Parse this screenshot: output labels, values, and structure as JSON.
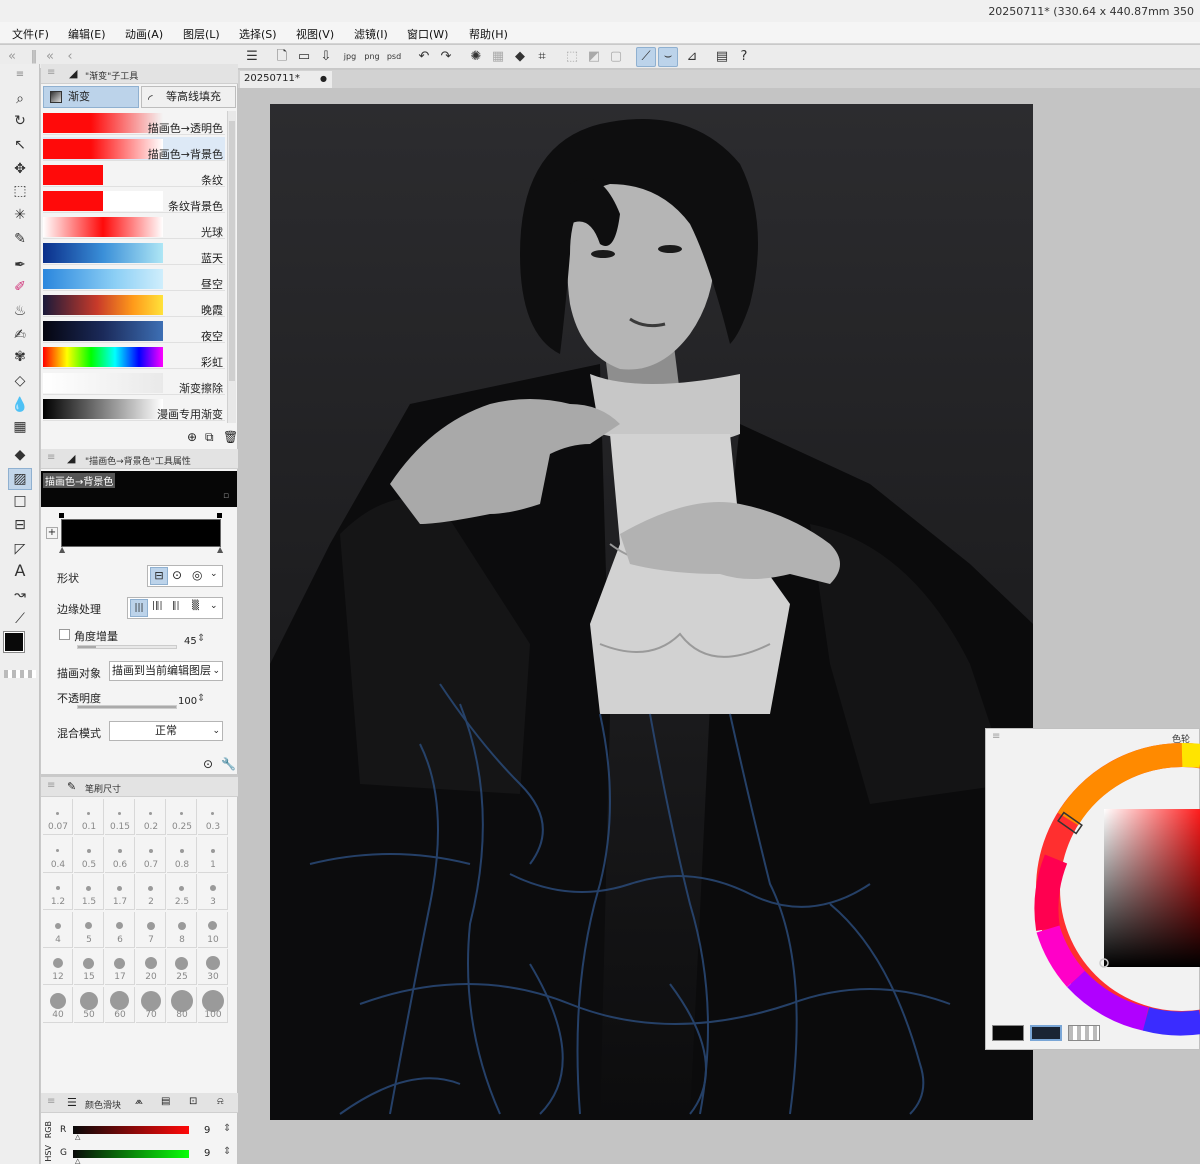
{
  "titlebar": {
    "text": "20250711* (330.64 x 440.87mm 350"
  },
  "menu": [
    "文件(F)",
    "编辑(E)",
    "动画(A)",
    "图层(L)",
    "选择(S)",
    "视图(V)",
    "滤镜(I)",
    "窗口(W)",
    "帮助(H)"
  ],
  "document": {
    "tab_label": "20250711*",
    "tab_marker": "●"
  },
  "subtool": {
    "panel_title": "\"渐变\"子工具",
    "tabs": [
      "渐变",
      "等高线填充"
    ],
    "gradients": [
      {
        "label": "描画色→透明色"
      },
      {
        "label": "描画色→背景色"
      },
      {
        "label": "条纹"
      },
      {
        "label": "条纹背景色"
      },
      {
        "label": "光球"
      },
      {
        "label": "蓝天"
      },
      {
        "label": "昼空"
      },
      {
        "label": "晚霞"
      },
      {
        "label": "夜空"
      },
      {
        "label": "彩虹"
      },
      {
        "label": "渐变擦除"
      },
      {
        "label": "漫画专用渐变"
      }
    ],
    "selected_index": 1
  },
  "tool_property": {
    "panel_title": "\"描画色→背景色\"工具属性",
    "preview_label": "描画色→背景色",
    "shape_label": "形状",
    "edge_label": "边缘处理",
    "angle_step_label": "角度增量",
    "angle_step_value": "45",
    "target_label": "描画对象",
    "target_value": "描画到当前编辑图层",
    "opacity_label": "不透明度",
    "opacity_value": "100",
    "blend_label": "混合模式",
    "blend_value": "正常"
  },
  "brush_size": {
    "panel_title": "笔刷尺寸",
    "sizes": [
      "0.07",
      "0.1",
      "0.15",
      "0.2",
      "0.25",
      "0.3",
      "0.4",
      "0.5",
      "0.6",
      "0.7",
      "0.8",
      "1",
      "1.2",
      "1.5",
      "1.7",
      "2",
      "2.5",
      "3",
      "4",
      "5",
      "6",
      "7",
      "8",
      "10",
      "12",
      "15",
      "17",
      "20",
      "25",
      "30",
      "40",
      "50",
      "60",
      "70",
      "80",
      "100"
    ]
  },
  "color_slider": {
    "panel_title": "颜色滑块",
    "mode_rgb": "RGB",
    "mode_hsv": "HSV",
    "r_label": "R",
    "r_value": "9",
    "g_label": "G",
    "g_value": "9"
  },
  "color_wheel": {
    "panel_title": "色轮"
  },
  "colors": {
    "accent": "#bcd3ea",
    "main_color": "#090909",
    "sub_color": "#1a2433"
  }
}
